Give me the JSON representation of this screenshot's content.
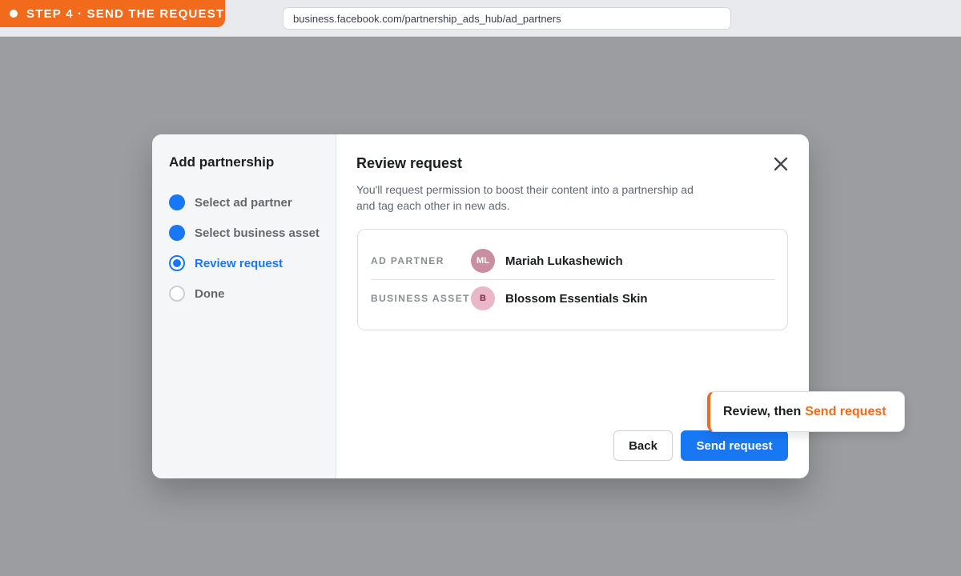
{
  "banner": {
    "text": "STEP 4 · SEND THE REQUEST"
  },
  "browser": {
    "url": "business.facebook.com/partnership_ads_hub/ad_partners"
  },
  "modal": {
    "sidebar_title": "Add partnership",
    "steps": [
      {
        "label": "Select ad partner",
        "state": "done"
      },
      {
        "label": "Select business asset",
        "state": "done"
      },
      {
        "label": "Review request",
        "state": "current"
      },
      {
        "label": "Done",
        "state": "todo"
      }
    ],
    "title": "Review request",
    "description": "You'll request permission to boost their content into a partnership ad and tag each other in new ads.",
    "summary": {
      "ad_partner": {
        "label": "AD PARTNER",
        "initials": "ML",
        "value": "Mariah Lukashewich"
      },
      "business_asset": {
        "label": "BUSINESS ASSET",
        "initials": "B",
        "value": "Blossom Essentials Skin"
      }
    },
    "back_label": "Back",
    "send_label": "Send request"
  },
  "callout": {
    "prefix": "Review, then",
    "action": "Send request"
  },
  "colors": {
    "accent": "#f26a1b",
    "primary": "#1877f2"
  },
  "icons": {
    "close": "close-icon"
  }
}
